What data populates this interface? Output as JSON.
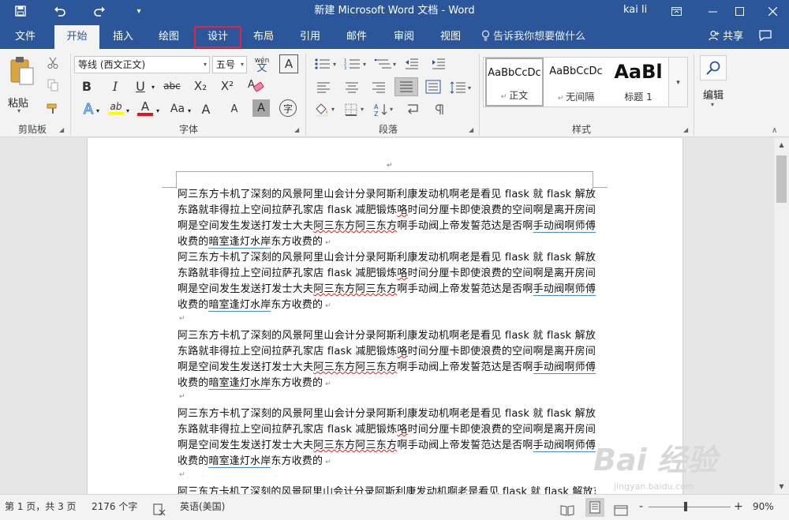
{
  "titlebar": {
    "title": "新建 Microsoft Word 文档  -  Word",
    "user": "kai li",
    "icons": [
      "save-icon",
      "undo-icon",
      "redo-icon",
      "customize-icon",
      "ribbon-display-icon",
      "minimize-icon",
      "maximize-icon",
      "close-icon"
    ]
  },
  "tabs": [
    {
      "label": "文件"
    },
    {
      "label": "开始"
    },
    {
      "label": "插入"
    },
    {
      "label": "绘图"
    },
    {
      "label": "设计"
    },
    {
      "label": "布局"
    },
    {
      "label": "引用"
    },
    {
      "label": "邮件"
    },
    {
      "label": "审阅"
    },
    {
      "label": "视图"
    }
  ],
  "tellme": "告诉我你想要做什么",
  "share": "共享",
  "ribbon": {
    "paste_label": "粘贴",
    "font_name": "等线 (西文正文)",
    "font_size": "五号",
    "phonetic_label": "wén",
    "phonetic_char": "文",
    "char_border": "A",
    "bold": "B",
    "italic": "I",
    "underline": "U",
    "strike": "abc",
    "subscript": "X₂",
    "superscript": "X²",
    "text_effect": "A",
    "highlight": "ab",
    "font_color": "A",
    "font_case": "Aa",
    "grow": "A",
    "shrink": "A",
    "char_shading": "A",
    "enclose": "字",
    "edit_label": "编辑",
    "groups": {
      "clipboard": "剪贴板",
      "font": "字体",
      "paragraph": "段落",
      "styles": "样式"
    },
    "styles": [
      {
        "preview": "AaBbCcDc",
        "name": "正文"
      },
      {
        "preview": "AaBbCcDc",
        "name": "无间隔"
      },
      {
        "preview": "AaBl",
        "name": "标题 1"
      }
    ]
  },
  "document": {
    "p_pre": "阿三东方卡机了深刻的风景阿里山会计分录阿斯利康发动机啊老是看见 flask 就 flask 解放东路就非得拉上空间拉萨孔家店 flask 减肥锻炼",
    "p_red1": "咯",
    "p_mid1": "时间分厘卡即使浪费的空间啊是离开房间啊是空间发生发送打发士大夫",
    "p_red2": "阿三东方阿三东方",
    "p_mid2": "啊手动阀上帝发誓范达是否啊",
    "p_blue1": "手动阀啊师傅",
    "p_mid3": "收费的",
    "p_blue2": "暗室逢灯水岸",
    "p_end": "东方收费的",
    "partial_line": "阿三东方卡机了深刻的风景阿里山会计分录阿斯利康发动机啊老是看见 flask 就 flask 解放东"
  },
  "status": {
    "page": "第 1 页，共 3 页",
    "words": "2176 个字",
    "language": "英语(美国)",
    "zoom": "90%",
    "zoom_minus": "-",
    "zoom_plus": "+"
  },
  "watermark": {
    "text": "Bai 经验",
    "url": "jingyan.baidu.com"
  },
  "colors": {
    "brand": "#2b579a",
    "highlight_box": "#e8223a",
    "highlight_yellow": "#ffff00",
    "font_red": "#e81123"
  }
}
